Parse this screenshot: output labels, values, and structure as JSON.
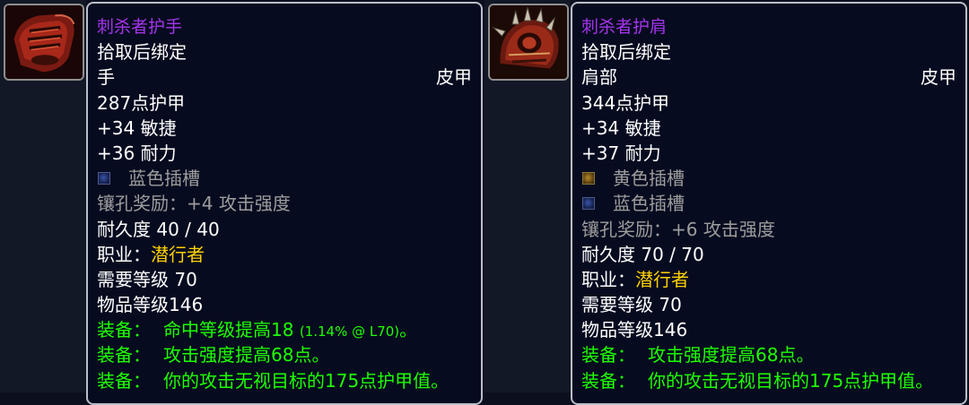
{
  "items": [
    {
      "icon": "leather-gloves-icon",
      "name": "刺杀者护手",
      "bind": "拾取后绑定",
      "slot": "手",
      "type": "皮甲",
      "armor": "287点护甲",
      "stats": [
        "+34 敏捷",
        "+36 耐力"
      ],
      "sockets": [
        {
          "color": "blue",
          "label": "蓝色插槽"
        }
      ],
      "socket_bonus": "镶孔奖励：+4 攻击强度",
      "durability": "耐久度 40 / 40",
      "class_label": "职业：",
      "class_value": "潜行者",
      "req_level": "需要等级 70",
      "item_level": "物品等级146",
      "equips": [
        {
          "label": "装备：",
          "text": "命中等级提高18",
          "note": "(1.14% @ L70)",
          "tail": "。"
        },
        {
          "label": "装备：",
          "text": "攻击强度提高68点。"
        },
        {
          "label": "装备：",
          "text": "你的攻击无视目标的175点护甲值。"
        }
      ]
    },
    {
      "icon": "spiked-shoulder-icon",
      "name": "刺杀者护肩",
      "bind": "拾取后绑定",
      "slot": "肩部",
      "type": "皮甲",
      "armor": "344点护甲",
      "stats": [
        "+34 敏捷",
        "+37 耐力"
      ],
      "sockets": [
        {
          "color": "yellow",
          "label": "黄色插槽"
        },
        {
          "color": "blue",
          "label": "蓝色插槽"
        }
      ],
      "socket_bonus": "镶孔奖励：+6 攻击强度",
      "durability": "耐久度 70 / 70",
      "class_label": "职业：",
      "class_value": "潜行者",
      "req_level": "需要等级 70",
      "item_level": "物品等级146",
      "equips": [
        {
          "label": "装备：",
          "text": "攻击强度提高68点。"
        },
        {
          "label": "装备：",
          "text": "你的攻击无视目标的175点护甲值。"
        }
      ]
    }
  ],
  "colors": {
    "epic": "#a335ee",
    "green": "#1eff00",
    "gray": "#9d9d9d",
    "class": "#ffd100"
  }
}
